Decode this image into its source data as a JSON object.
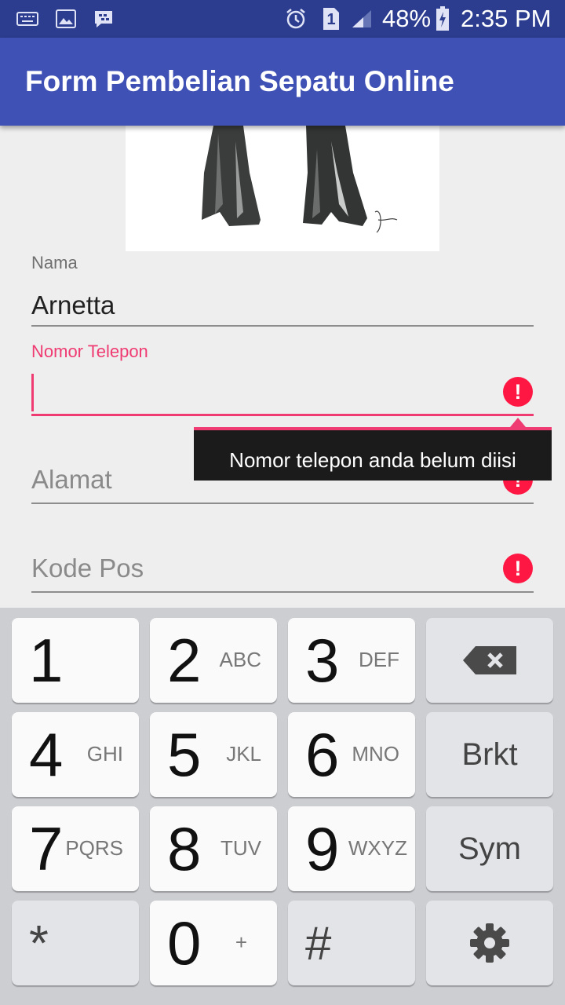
{
  "status_bar": {
    "battery": "48%",
    "time": "2:35 PM",
    "sim_badge": "1",
    "icons": [
      "keyboard-icon",
      "gallery-icon",
      "bbm-icon",
      "alarm-icon",
      "sim-icon",
      "signal-icon",
      "battery-charging-icon"
    ]
  },
  "app_bar": {
    "title": "Form Pembelian Sepatu Online"
  },
  "form": {
    "nama_label": "Nama",
    "nama_value": "Arnetta",
    "telepon_label": "Nomor Telepon",
    "telepon_value": "",
    "alamat_hint": "Alamat",
    "kodepos_hint": "Kode Pos",
    "error_tooltip": "Nomor telepon anda belum diisi",
    "error_icon_glyph": "!"
  },
  "keyboard": {
    "keys": [
      {
        "num": "1",
        "letters": ""
      },
      {
        "num": "2",
        "letters": "ABC"
      },
      {
        "num": "3",
        "letters": "DEF"
      },
      {
        "num": "4",
        "letters": "GHI"
      },
      {
        "num": "5",
        "letters": "JKL"
      },
      {
        "num": "6",
        "letters": "MNO"
      },
      {
        "num": "7",
        "letters": "PQRS"
      },
      {
        "num": "8",
        "letters": "TUV"
      },
      {
        "num": "9",
        "letters": "WXYZ"
      },
      {
        "num": "0",
        "letters": "+"
      }
    ],
    "brkt": "Brkt",
    "sym": "Sym",
    "star": "*",
    "hash": "#",
    "backspace_icon": "backspace-icon",
    "settings_icon": "gear-icon"
  },
  "colors": {
    "status_bar": "#2c3d8f",
    "app_bar": "#3f51b5",
    "error_accent": "#ef3b72",
    "error_icon": "#ff1744",
    "tooltip_bg": "#1b1b1b"
  }
}
